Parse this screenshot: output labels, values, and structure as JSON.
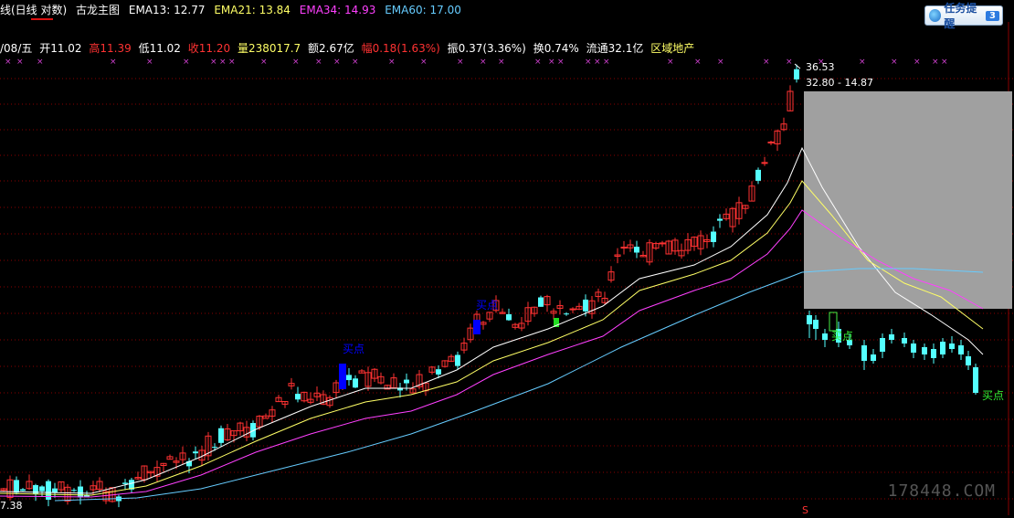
{
  "header": {
    "title_prefix": "线(日线 对数)",
    "indicator_name": "古龙主图",
    "ema13": "EMA13: 12.77",
    "ema21": "EMA21: 13.84",
    "ema34": "EMA34: 14.93",
    "ema60": "EMA60: 17.00"
  },
  "task_button": {
    "label": "任务提醒",
    "count": "3"
  },
  "info_bar": {
    "date": "/08/五",
    "open": "开11.02",
    "high": "高11.39",
    "low": "低11.02",
    "close": "收11.20",
    "volume": "量238017.7",
    "amount": "额2.67亿",
    "change": "幅0.18(1.63%)",
    "amplitude": "振0.37(3.36%)",
    "turnover": "换0.74%",
    "float": "流通32.1亿",
    "sector": "区域地产"
  },
  "annotations": {
    "high_price": "36.53",
    "range_text": "32.80 - 14.87",
    "bottom_price": "7.38",
    "buy_1": "买点",
    "buy_2": "买点",
    "buy_3": "买点",
    "buy_4": "买点",
    "s_marker": "S"
  },
  "watermark": "178448.COM",
  "colors": {
    "up": "#ff3232",
    "down": "#54ffff",
    "ema13": "#ffffff",
    "ema21": "#ffff66",
    "ema34": "#ff40ff",
    "ema60": "#66ccff",
    "grid": "#8a0000",
    "buy_blue": "#0000ff",
    "selection": "#a0a0a0"
  },
  "chart_data": {
    "type": "candlestick",
    "title": "古龙主图",
    "series": [
      {
        "name": "EMA13",
        "last": 12.77
      },
      {
        "name": "EMA21",
        "last": 13.84
      },
      {
        "name": "EMA34",
        "last": 14.93
      },
      {
        "name": "EMA60",
        "last": 17.0
      }
    ],
    "high": 36.53,
    "low": 7.38,
    "selected_range": [
      32.8,
      14.87
    ]
  }
}
